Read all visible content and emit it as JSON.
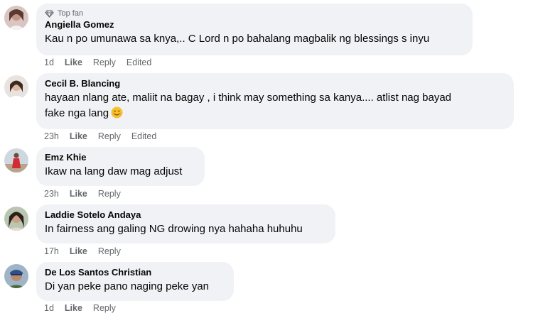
{
  "comments": [
    {
      "badge": "Top fan",
      "name": "Angiella Gomez",
      "lines": [
        "Kau n po umunawa sa knya,.. C Lord n po bahalang magbalik ng blessings s inyu"
      ],
      "time": "1d",
      "like": "Like",
      "reply": "Reply",
      "edited": "Edited",
      "avatar_icon": "avatar-photo"
    },
    {
      "name": "Cecil B. Blancing",
      "lines": [
        "hayaan nlang ate, maliit na bagay , i think may something sa kanya.... atlist nag bayad",
        "fake nga lang"
      ],
      "emoji": "smiling-face-emoji",
      "time": "23h",
      "like": "Like",
      "reply": "Reply",
      "edited": "Edited",
      "avatar_icon": "avatar-photo"
    },
    {
      "name": "Emz Khie",
      "lines": [
        "Ikaw na lang daw mag adjust"
      ],
      "time": "23h",
      "like": "Like",
      "reply": "Reply",
      "avatar_icon": "avatar-photo"
    },
    {
      "name": "Laddie Sotelo Andaya",
      "lines": [
        "In fairness ang galing NG drowing nya hahaha huhuhu"
      ],
      "time": "17h",
      "like": "Like",
      "reply": "Reply",
      "avatar_icon": "avatar-photo"
    },
    {
      "name": "De Los Santos Christian",
      "lines": [
        "Di yan peke pano naging peke yan"
      ],
      "time": "1d",
      "like": "Like",
      "reply": "Reply",
      "avatar_icon": "avatar-photo"
    }
  ],
  "colors": {
    "bubble": "#f0f2f5",
    "name": "#050505",
    "meta": "#65676b"
  }
}
